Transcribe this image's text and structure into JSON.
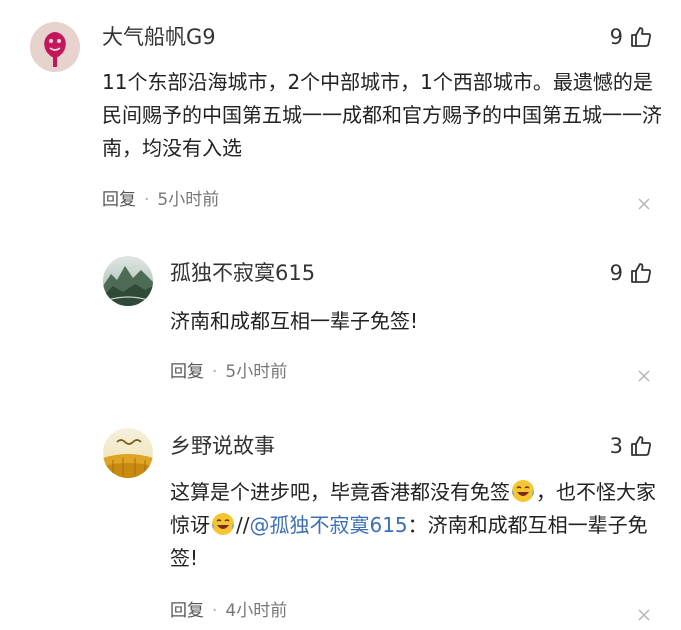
{
  "comments": [
    {
      "username": "大气船帆G9",
      "likes": "9",
      "content": "11个东部沿海城市，2个中部城市，1个西部城市。最遗憾的是民间赐予的中国第五城一一成都和官方赐予的中国第五城一一济南，均没有入选",
      "reply_label": "回复",
      "separator": "·",
      "time": "5小时前",
      "avatar_icon": "logo-avatar-icon",
      "avatar_color": "#c2185b"
    },
    {
      "username": "孤独不寂寞615",
      "likes": "9",
      "content": "济南和成都互相一辈子免签!",
      "reply_label": "回复",
      "separator": "·",
      "time": "5小时前",
      "avatar_icon": "landscape-avatar-icon"
    },
    {
      "username": "乡野说故事",
      "likes": "3",
      "content_part1": "这算是个进步吧，毕竟香港都没有免签",
      "content_part2": "，也不怪大家惊讶",
      "content_part3": "//",
      "mention": "@孤独不寂寞615",
      "content_part4": "：济南和成都互相一辈子免签!",
      "reply_label": "回复",
      "separator": "·",
      "time": "4小时前",
      "avatar_icon": "wheat-field-avatar-icon",
      "emoji_icon": "laughing-tears-emoji-icon"
    }
  ],
  "icons": {
    "like": "thumbs-up-icon",
    "close": "close-icon"
  },
  "colors": {
    "mention": "#3d6fb4",
    "text": "#222222",
    "meta": "#777777"
  }
}
